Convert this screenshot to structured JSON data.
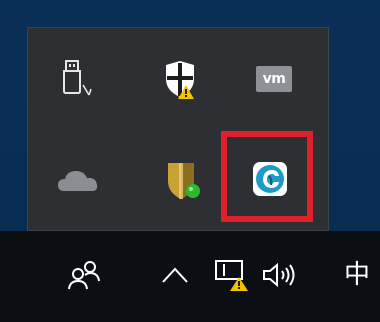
{
  "notification_area_overflow": {
    "icons": [
      {
        "name": "usb-safely-remove-icon"
      },
      {
        "name": "windows-defender-warning-icon"
      },
      {
        "name": "vmware-icon",
        "label": "vm"
      },
      {
        "name": "onedrive-cloud-icon"
      },
      {
        "name": "security-shield-app-icon"
      },
      {
        "name": "teal-app-icon"
      }
    ],
    "highlight_color": "#e01f2d"
  },
  "taskbar": {
    "people_icon": "people-icon",
    "show_hidden_icons": "chevron-up-icon",
    "network_icon": "network-warning-icon",
    "volume_icon": "volume-icon",
    "input_method_label": "中"
  },
  "colors": {
    "desktop": "#0a2f57",
    "flyout": "#2d2f33",
    "taskbar": "#0b0f14",
    "warning": "#f2c200",
    "accent_teal": "#1e9cc8"
  }
}
